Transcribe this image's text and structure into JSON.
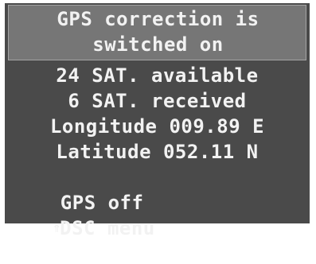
{
  "status": {
    "title_line1": "GPS correction is",
    "title_line2": "switched on"
  },
  "info": {
    "sat_available": "24 SAT. available",
    "sat_received": "6 SAT. received",
    "longitude": "Longitude 009.89 E",
    "latitude": "Latitude 052.11 N"
  },
  "menu": {
    "gps_off_label": "GPS off",
    "dsc_menu_label": "DSC menu",
    "dsc_menu_glyph": "⇑"
  }
}
